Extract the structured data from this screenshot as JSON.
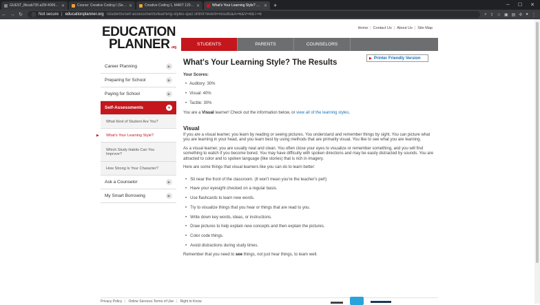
{
  "browser": {
    "tabs": [
      {
        "title": "GUEST_8bcab735-a25f-4009-91...",
        "favicon": "generic"
      },
      {
        "title": "Course: Creative Coding I (Sect...",
        "favicon": "amber"
      },
      {
        "title": "Creative Coding 1, MART 120 (...",
        "favicon": "amber"
      },
      {
        "title": "What's Your Learning Style? The...",
        "favicon": "red",
        "active": true
      }
    ],
    "new_tab_icon": "+",
    "security_label": "Not secure",
    "domain": "educationplanner.org",
    "path": "/students/self-assessments/learning-styles-quiz.shtml?event=results&A=6&V=8&T=6"
  },
  "header": {
    "logo_line1": "EDUCATION",
    "logo_line2": "PLANNER",
    "logo_suffix": ".org",
    "top_links": [
      "Home",
      "Contact Us",
      "About Us",
      "Site Map"
    ],
    "main_nav": [
      {
        "label": "STUDENTS",
        "active": true
      },
      {
        "label": "PARENTS",
        "active": false
      },
      {
        "label": "COUNSELORS",
        "active": false
      }
    ]
  },
  "sidebar": {
    "items": [
      {
        "label": "Career Planning"
      },
      {
        "label": "Preparing for School"
      },
      {
        "label": "Paying for School"
      }
    ],
    "active_item": "Self-Assessments",
    "sub_items": [
      {
        "label": "What Kind of Student Are You?"
      },
      {
        "label": "What's Your Learning Style?"
      },
      {
        "label": "Which Study Habits Can You Improve?"
      },
      {
        "label": "How Strong Is Your Character?"
      }
    ],
    "items_after": [
      {
        "label": "Ask a Counselor"
      },
      {
        "label": "My Smart Borrowing"
      }
    ]
  },
  "content": {
    "title": "What's Your Learning Style? The Results",
    "scores_label": "Your Scores:",
    "print_button": "Printer Friendly Version",
    "scores": [
      "Auditory: 30%",
      "Visual: 40%",
      "Tactile: 30%"
    ],
    "result_pre": "You are a ",
    "result_style": "Visual",
    "result_mid": " learner! Check out the information below, or ",
    "result_link": "view all of the learning styles",
    "result_post": ".",
    "section_title": "Visual",
    "para1": "If you are a visual learner, you learn by reading or seeing pictures. You understand and remember things by sight. You can picture what you are learning in your head, and you learn best by using methods that are primarily visual. You like to see what you are learning.",
    "para2": "As a visual learner, you are usually neat and clean. You often close your eyes to visualize or remember something, and you will find something to watch if you become bored. You may have difficulty with spoken directions and may be easily distracted by sounds. You are attracted to color and to spoken language (like stories) that is rich in imagery.",
    "para3": "Here are some things that visual learners like you can do to learn better:",
    "tips": [
      "Sit near the front of the classroom. (It won't mean you're the teacher's pet!)",
      "Have your eyesight checked on a regular basis.",
      "Use flashcards to learn new words.",
      "Try to visualize things that you hear or things that are read to you.",
      "Write down key words, ideas, or instructions.",
      "Draw pictures to help explain new concepts and then explain the pictures.",
      "Color code things.",
      "Avoid distractions during study times."
    ],
    "closing_pre": "Remember that you need to ",
    "closing_bold": "see",
    "closing_post": " things, not just hear things, to learn well."
  },
  "footer": {
    "links": [
      "Privacy Policy",
      "Online Services Terms of Use",
      "Right to Know"
    ]
  },
  "colors": {
    "accent": "#c4161c",
    "link": "#1a6fb5",
    "nav_gray": "#6d6e70"
  }
}
